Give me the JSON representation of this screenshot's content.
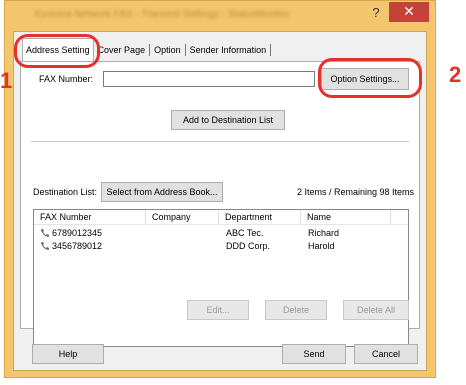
{
  "window": {
    "title": "Kyocera Network FAX - Transmit Settings - StatusMonitor",
    "help_glyph": "?",
    "close_glyph": "✕"
  },
  "tabs": [
    {
      "label": "Address Setting"
    },
    {
      "label": "Cover Page"
    },
    {
      "label": "Option"
    },
    {
      "label": "Sender Information"
    }
  ],
  "address": {
    "fax_number_label": "FAX Number:",
    "fax_number_value": "",
    "option_settings_button": "Option Settings...",
    "add_to_destination_button": "Add to Destination List",
    "destination_list_label": "Destination List:",
    "select_from_address_book_button": "Select from Address Book...",
    "items_status": "2 Items / Remaining 98  Items"
  },
  "destination_table": {
    "columns": [
      "FAX Number",
      "Company",
      "Department",
      "Name"
    ],
    "rows": [
      {
        "fax": "6789012345",
        "company": "",
        "department": "ABC Tec.",
        "name": "Richard"
      },
      {
        "fax": "3456789012",
        "company": "",
        "department": "DDD Corp.",
        "name": "Harold"
      }
    ]
  },
  "list_actions": {
    "edit": "Edit...",
    "delete": "Delete",
    "delete_all": "Delete All"
  },
  "footer": {
    "help": "Help",
    "send": "Send",
    "cancel": "Cancel"
  },
  "callouts": {
    "one": "1",
    "two": "2"
  },
  "colors": {
    "window_frame": "#f4c66d",
    "close_button": "#c7413b",
    "callout": "#e6312b"
  }
}
